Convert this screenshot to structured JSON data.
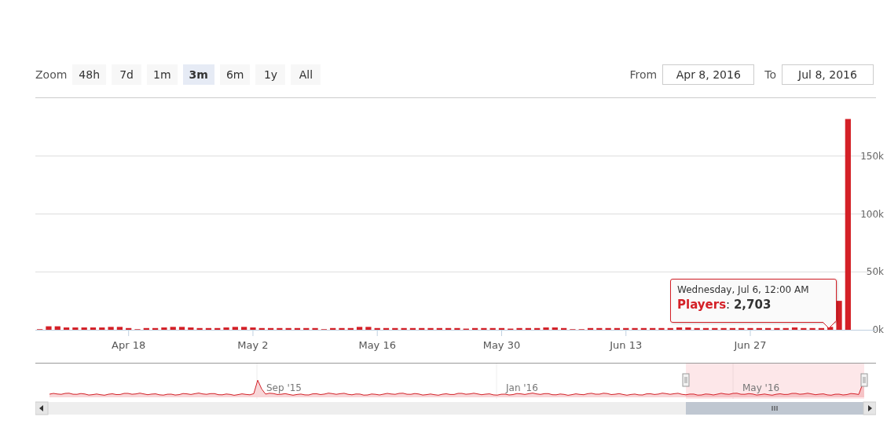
{
  "range_selector": {
    "label": "Zoom",
    "buttons": [
      {
        "label": "48h",
        "selected": false
      },
      {
        "label": "7d",
        "selected": false
      },
      {
        "label": "1m",
        "selected": false
      },
      {
        "label": "3m",
        "selected": true
      },
      {
        "label": "6m",
        "selected": false
      },
      {
        "label": "1y",
        "selected": false
      },
      {
        "label": "All",
        "selected": false
      }
    ]
  },
  "date_range": {
    "from_label": "From",
    "from": "Apr 8, 2016",
    "to_label": "To",
    "to": "Jul 8, 2016"
  },
  "chart": {
    "chart_data": {
      "type": "bar",
      "grid": true,
      "ylim": [
        0,
        200000
      ],
      "yticks": [
        {
          "value": 0,
          "label": "0k"
        },
        {
          "value": 50000,
          "label": "50k"
        },
        {
          "value": 100000,
          "label": "100k"
        },
        {
          "value": 150000,
          "label": "150k"
        }
      ],
      "categories": [
        null,
        null,
        null,
        null,
        null,
        null,
        null,
        null,
        null,
        null,
        "Apr 18",
        null,
        null,
        null,
        null,
        null,
        null,
        null,
        null,
        null,
        null,
        null,
        null,
        null,
        "May 2",
        null,
        null,
        null,
        null,
        null,
        null,
        null,
        null,
        null,
        null,
        null,
        null,
        null,
        "May 16",
        null,
        null,
        null,
        null,
        null,
        null,
        null,
        null,
        null,
        null,
        null,
        null,
        null,
        "May 30",
        null,
        null,
        null,
        null,
        null,
        null,
        null,
        null,
        null,
        null,
        null,
        null,
        null,
        "Jun 13",
        null,
        null,
        null,
        null,
        null,
        null,
        null,
        null,
        null,
        null,
        null,
        null,
        null,
        "Jun 27",
        null,
        null,
        null,
        null,
        null,
        null,
        null,
        null,
        null,
        null,
        null
      ],
      "series": [
        {
          "name": "Players",
          "color": "#d42027",
          "values": [
            500,
            3000,
            3000,
            2000,
            2000,
            2000,
            2000,
            2000,
            2500,
            2500,
            1500,
            500,
            1500,
            1500,
            2000,
            2500,
            2500,
            2000,
            1500,
            1500,
            1500,
            2000,
            2500,
            2500,
            2000,
            1500,
            1500,
            1500,
            1500,
            1500,
            1500,
            1500,
            500,
            1500,
            1500,
            1500,
            2500,
            2500,
            1500,
            1500,
            1500,
            1500,
            1500,
            1500,
            1500,
            1500,
            1500,
            1500,
            1000,
            1500,
            1500,
            1500,
            1500,
            1000,
            1500,
            1500,
            1500,
            2000,
            2000,
            1500,
            500,
            500,
            1500,
            1500,
            1500,
            1500,
            1500,
            1500,
            1500,
            1500,
            1500,
            1500,
            2000,
            2000,
            1500,
            1500,
            1500,
            1500,
            1500,
            1500,
            1500,
            1500,
            1500,
            1500,
            1500,
            2000,
            1500,
            1500,
            1500,
            2500,
            25000,
            182000
          ]
        }
      ]
    }
  },
  "tooltip": {
    "header": "Wednesday, Jul 6, 12:00 AM",
    "value": ": **2,703**"
  },
  "navigator": {
    "labels": [
      "Sep '15",
      "Jan '16",
      "May '16"
    ]
  }
}
